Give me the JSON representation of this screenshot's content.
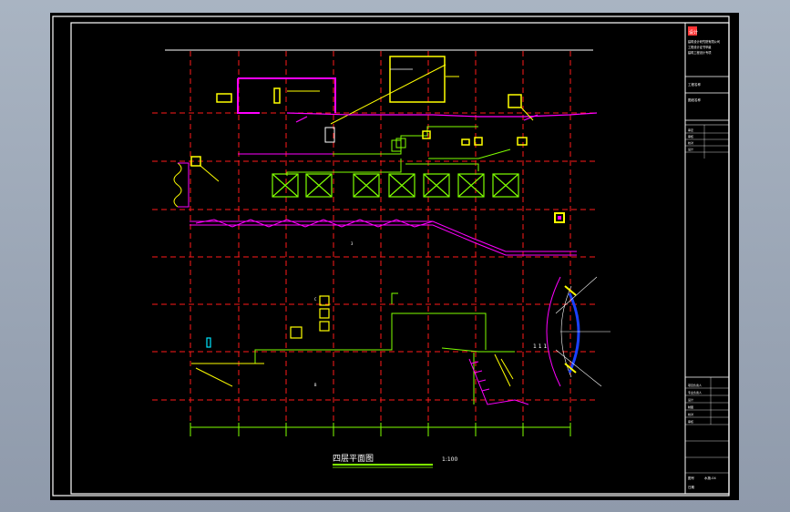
{
  "drawing": {
    "title": "四层平面图",
    "scale": "1:100",
    "note_1": "C",
    "note_2": "3",
    "note_3": "B",
    "legend_caption": "1 1 1",
    "gridline_color": "#ff1a1a",
    "wall_color": "#ff00ff",
    "pipe_color": "#7fff00",
    "equipment_color": "#ffff00",
    "detail_color": "#1a40ff"
  },
  "title_block": {
    "logo_text": "设计",
    "company_lines": [
      "建筑设计研究院有限公司",
      "工程设计证书甲级",
      "建筑工程设计专项"
    ],
    "project_label": "工程名称",
    "drawing_name_label": "图纸名称",
    "rows_upper": [
      "审定",
      "审核",
      "校对",
      "设计"
    ],
    "rows_lower": [
      "项目负责人",
      "专业负责人",
      "设计",
      "制图",
      "校对",
      "审核"
    ],
    "sheet_label": "图号",
    "sheet_value": "水施-04",
    "date_label": "日期"
  }
}
